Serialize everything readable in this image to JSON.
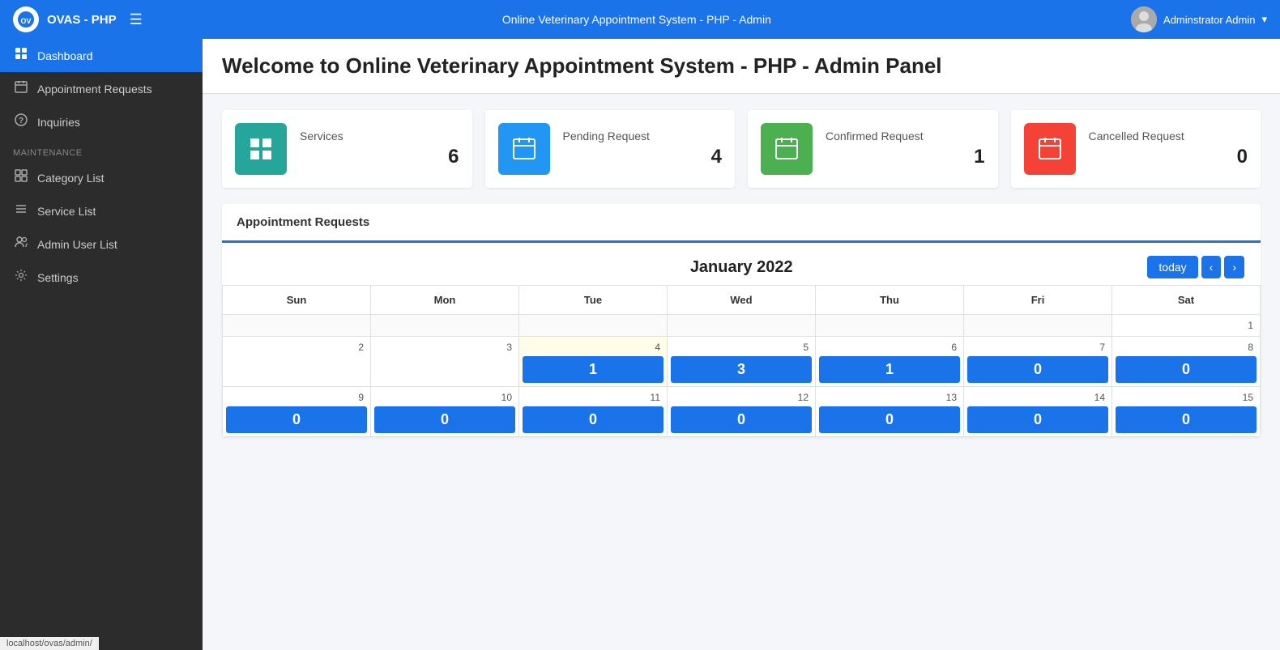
{
  "navbar": {
    "brand": "OVAS - PHP",
    "title": "Online Veterinary Appointment System - PHP - Admin",
    "user": "Adminstrator Admin"
  },
  "sidebar": {
    "active": "Dashboard",
    "items": [
      {
        "id": "dashboard",
        "label": "Dashboard",
        "icon": "🏠",
        "active": true
      },
      {
        "id": "appointment-requests",
        "label": "Appointment Requests",
        "icon": "📅",
        "active": false
      },
      {
        "id": "inquiries",
        "label": "Inquiries",
        "icon": "❓",
        "active": false
      }
    ],
    "maintenance_label": "Maintenance",
    "maintenance_items": [
      {
        "id": "category-list",
        "label": "Category List",
        "icon": "▦",
        "active": false
      },
      {
        "id": "service-list",
        "label": "Service List",
        "icon": "☰",
        "active": false
      },
      {
        "id": "admin-user-list",
        "label": "Admin User List",
        "icon": "👥",
        "active": false
      },
      {
        "id": "settings",
        "label": "Settings",
        "icon": "⚙",
        "active": false
      }
    ]
  },
  "page": {
    "title": "Welcome to Online Veterinary Appointment System - PHP - Admin Panel"
  },
  "stats": [
    {
      "id": "services",
      "label": "Services",
      "value": "6",
      "icon": "▦",
      "color": "teal"
    },
    {
      "id": "pending",
      "label": "Pending Request",
      "value": "4",
      "icon": "📅",
      "color": "blue"
    },
    {
      "id": "confirmed",
      "label": "Confirmed Request",
      "value": "1",
      "icon": "📅",
      "color": "green"
    },
    {
      "id": "cancelled",
      "label": "Cancelled Request",
      "value": "0",
      "icon": "📅",
      "color": "red"
    }
  ],
  "calendar": {
    "section_title": "Appointment Requests",
    "month_title": "January 2022",
    "today_btn": "today",
    "prev_btn": "‹",
    "next_btn": "›",
    "days": [
      "Sun",
      "Mon",
      "Tue",
      "Wed",
      "Thu",
      "Fri",
      "Sat"
    ],
    "weeks": [
      [
        {
          "num": "",
          "empty": true,
          "today": false,
          "event": null
        },
        {
          "num": "",
          "empty": true,
          "today": false,
          "event": null
        },
        {
          "num": "",
          "empty": true,
          "today": false,
          "event": null
        },
        {
          "num": "",
          "empty": true,
          "today": false,
          "event": null
        },
        {
          "num": "",
          "empty": true,
          "today": false,
          "event": null
        },
        {
          "num": "",
          "empty": true,
          "today": false,
          "event": null
        },
        {
          "num": "1",
          "empty": false,
          "today": false,
          "event": null
        }
      ],
      [
        {
          "num": "2",
          "empty": false,
          "today": false,
          "event": null
        },
        {
          "num": "3",
          "empty": false,
          "today": false,
          "event": null
        },
        {
          "num": "4",
          "empty": false,
          "today": true,
          "event": "1"
        },
        {
          "num": "5",
          "empty": false,
          "today": false,
          "event": "3"
        },
        {
          "num": "6",
          "empty": false,
          "today": false,
          "event": "1"
        },
        {
          "num": "7",
          "empty": false,
          "today": false,
          "event": "0"
        },
        {
          "num": "8",
          "empty": false,
          "today": false,
          "event": "0"
        }
      ],
      [
        {
          "num": "9",
          "empty": false,
          "today": false,
          "event": "0"
        },
        {
          "num": "10",
          "empty": false,
          "today": false,
          "event": "0"
        },
        {
          "num": "11",
          "empty": false,
          "today": false,
          "event": "0"
        },
        {
          "num": "12",
          "empty": false,
          "today": false,
          "event": "0"
        },
        {
          "num": "13",
          "empty": false,
          "today": false,
          "event": "0"
        },
        {
          "num": "14",
          "empty": false,
          "today": false,
          "event": "0"
        },
        {
          "num": "15",
          "empty": false,
          "today": false,
          "event": "0"
        }
      ]
    ]
  },
  "statusbar": {
    "url": "localhost/ovas/admin/"
  }
}
